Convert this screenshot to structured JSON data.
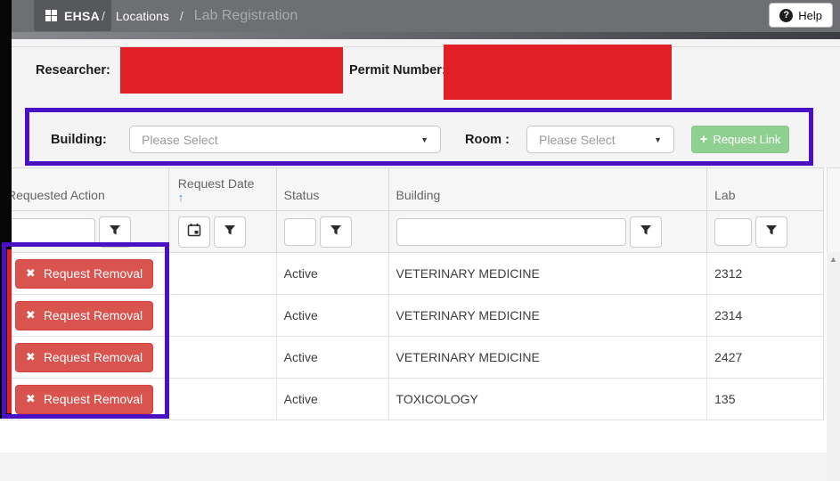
{
  "topbar": {
    "brand": "EHSA",
    "sep1": "/",
    "breadcrumb_section": "Locations",
    "sep2": "/",
    "breadcrumb_page": "Lab Registration",
    "help_icon": "?",
    "help_label": "Help"
  },
  "form": {
    "researcher_label": "Researcher:",
    "permit_label": "Permit Number:"
  },
  "link_panel": {
    "building_label": "Building:",
    "building_value": "Please Select",
    "room_label": "Room :",
    "room_value": "Please Select",
    "select_caret": "▼",
    "request_link_plus": "+",
    "request_link_label": "Request Link"
  },
  "table": {
    "headers": {
      "requested_action": "Requested Action",
      "request_date": "Request Date",
      "sort_arrow": "↑",
      "status": "Status",
      "building": "Building",
      "lab": "Lab"
    },
    "remove_icon": "✖",
    "remove_label": "Request Removal",
    "rows": [
      {
        "status": "Active",
        "building": "VETERINARY MEDICINE",
        "lab": "2312"
      },
      {
        "status": "Active",
        "building": "VETERINARY MEDICINE",
        "lab": "2314"
      },
      {
        "status": "Active",
        "building": "VETERINARY MEDICINE",
        "lab": "2427"
      },
      {
        "status": "Active",
        "building": "TOXICOLOGY",
        "lab": "135"
      }
    ],
    "scroll_up_arrow": "▲"
  },
  "colors": {
    "topbar_gray": "#6e6f72",
    "accent_purple": "#4a10c4",
    "redaction_red": "#e01f26",
    "danger_red": "#d9534f",
    "link_green": "#8fcf90",
    "sort_blue": "#4a90d9"
  }
}
